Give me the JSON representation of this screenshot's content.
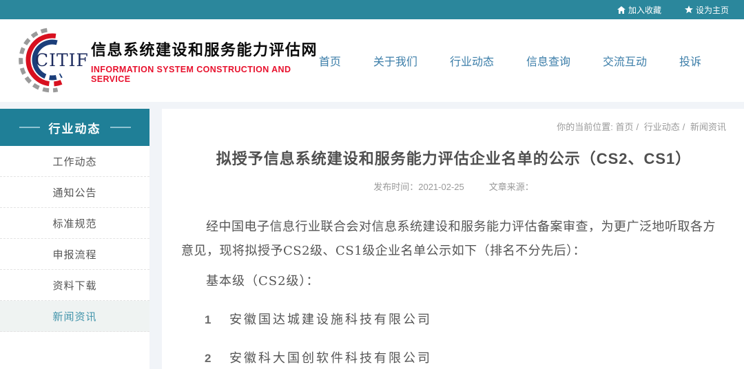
{
  "topbar": {
    "add_favorite": "加入收藏",
    "set_homepage": "设为主页"
  },
  "logo": {
    "acronym": "CITIF",
    "site_name": "信息系统建设和服务能力评估网",
    "site_subtitle": "INFORMATION SYSTEM CONSTRUCTION AND SERVICE"
  },
  "nav": {
    "items": [
      {
        "label": "首页"
      },
      {
        "label": "关于我们"
      },
      {
        "label": "行业动态"
      },
      {
        "label": "信息查询"
      },
      {
        "label": "交流互动"
      },
      {
        "label": "投诉"
      }
    ]
  },
  "sidebar": {
    "title": "行业动态",
    "items": [
      {
        "label": "工作动态",
        "active": false
      },
      {
        "label": "通知公告",
        "active": false
      },
      {
        "label": "标准规范",
        "active": false
      },
      {
        "label": "申报流程",
        "active": false
      },
      {
        "label": "资料下载",
        "active": false
      },
      {
        "label": "新闻资讯",
        "active": true
      }
    ]
  },
  "breadcrumb": {
    "label": "你的当前位置:",
    "separator": "/",
    "items": [
      "首页",
      "行业动态",
      "新闻资讯"
    ]
  },
  "article": {
    "title": "拟授予信息系统建设和服务能力评估企业名单的公示（CS2、CS1）",
    "publish_label": "发布时间：2021-02-25",
    "source_label": "文章来源：",
    "paragraph1": "经中国电子信息行业联合会对信息系统建设和服务能力评估备案审查，为更广泛地听取各方意见，现将拟授予CS2级、CS1级企业名单公示如下（排名不分先后）：",
    "paragraph2": "基本级（CS2级）：",
    "companies": [
      {
        "index": "1",
        "name": "安徽国达城建设施科技有限公司"
      },
      {
        "index": "2",
        "name": "安徽科大国创软件科技有限公司"
      }
    ]
  },
  "colors": {
    "topbar_teal": "#2b879c",
    "sidebar_teal": "#1f7f97",
    "nav_blue": "#3c7ea9",
    "subtitle_red": "#e8112d",
    "page_bg": "#f1f4f8"
  },
  "icons": {
    "favorite": "home-icon",
    "homepage": "star-icon"
  }
}
